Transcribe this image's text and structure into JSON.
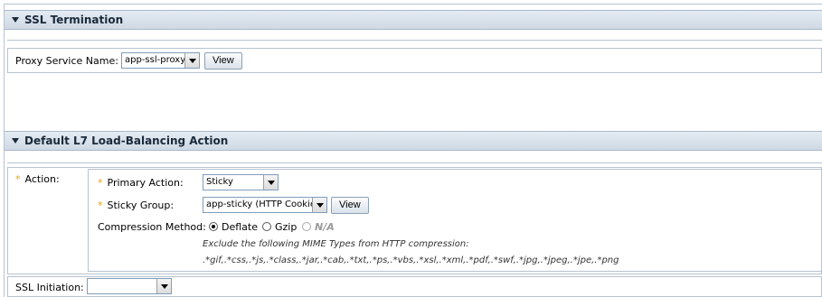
{
  "ssl_termination": {
    "header": "SSL Termination",
    "proxy_label": "Proxy Service Name:",
    "proxy_value": "app-ssl-proxy",
    "view_label": "View"
  },
  "l7_action": {
    "header": "Default L7 Load-Balancing Action",
    "action_label": "Action:",
    "primary_label": "Primary Action:",
    "primary_value": "Sticky",
    "sticky_label": "Sticky Group:",
    "sticky_value": "app-sticky (HTTP Cookie)",
    "view_label": "View",
    "compression_label": "Compression Method:",
    "compression_options": [
      "Deflate",
      "Gzip",
      "N/A"
    ],
    "compression_selected": "Deflate",
    "exclude_text": "Exclude the following MIME Types from HTTP compression:",
    "mime_types": ".*gif,.*css,.*js,.*class,.*jar,.*cab,.*txt,.*ps,.*vbs,.*xsl,.*xml,.*pdf,.*swf,.*jpg,.*jpeg,.*jpe,.*png"
  },
  "ssl_initiation": {
    "label": "SSL Initiation:",
    "value": ""
  },
  "colors": {
    "header_bg": "#cfd9e4",
    "required_star": "#e8a100",
    "border": "#b7c3cf"
  }
}
